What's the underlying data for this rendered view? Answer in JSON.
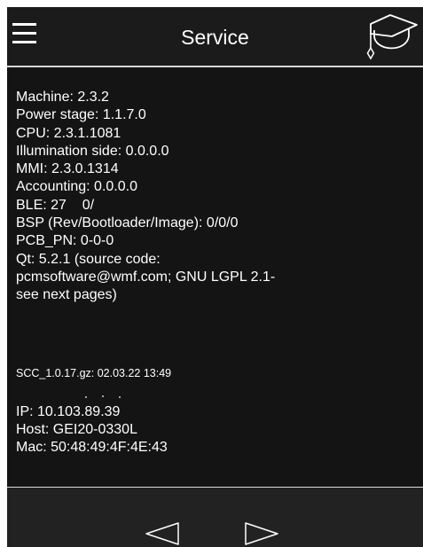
{
  "header": {
    "title": "Service",
    "menu_icon": "hamburger-menu-icon",
    "help_icon": "graduation-cap-icon"
  },
  "info": {
    "lines": [
      "Machine: 2.3.2",
      "Power stage: 1.1.7.0",
      "CPU: 2.3.1.1081",
      "Illumination side: 0.0.0.0",
      "MMI: 2.3.0.1314",
      "Accounting: 0.0.0.0",
      "BLE: 27    0/",
      "BSP (Rev/Bootloader/Image): 0/0/0",
      "PCB_PN: 0-0-0",
      "Qt: 5.2.1 (source code:",
      "pcmsoftware@wmf.com; GNU LGPL 2.1-",
      "see next pages)"
    ]
  },
  "firmware": "SCC_1.0.17.gz: 02.03.22 13:49",
  "network": {
    "ip": "IP: 10.103.89.39",
    "host": "Host: GEI20-0330L",
    "mac": "Mac: 50:48:49:4F:4E:43"
  },
  "footer": {
    "prev_icon": "triangle-left-icon",
    "next_icon": "triangle-right-icon"
  },
  "colors": {
    "background": "#141414",
    "header": "#1b1b1b",
    "footer": "#222222",
    "text": "#ffffff",
    "divider": "#d8d8d8"
  }
}
